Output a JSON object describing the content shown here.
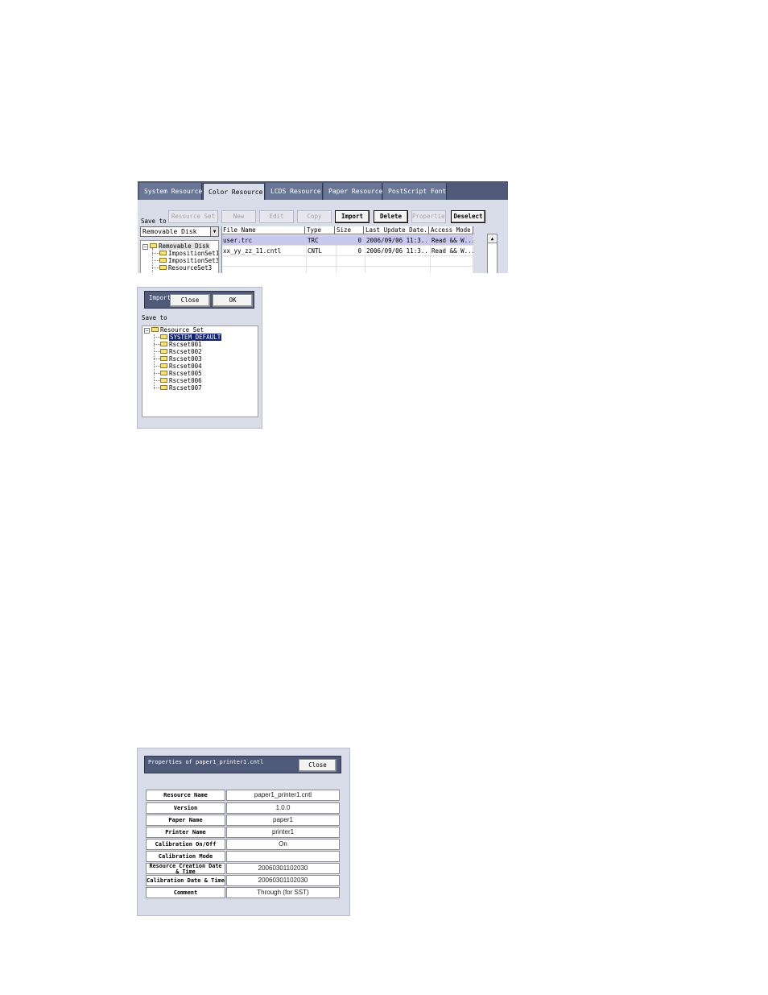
{
  "resource_window": {
    "tabs": [
      "System Resource",
      "Color Resource",
      "LCDS Resource",
      "Paper Resource",
      "PostScript Font"
    ],
    "active_tab": "Color Resource",
    "save_to_label": "Save to",
    "save_to_value": "Removable Disk",
    "buttons": {
      "resource_set": "Resource Set",
      "new": "New",
      "edit": "Edit",
      "copy": "Copy",
      "import": "Import",
      "delete": "Delete",
      "properties": "Properties",
      "deselect": "Deselect"
    },
    "tree": {
      "root": "Removable Disk",
      "children": [
        "ImpositionSet1",
        "ImpositionSet3",
        "ResourceSet3"
      ]
    },
    "columns": [
      "File Name",
      "Type",
      "Size",
      "Last Update Date...",
      "Access Mode"
    ],
    "rows": [
      {
        "file_name": "user.trc",
        "type": "TRC",
        "size": "0",
        "date": "2006/09/06 11:3...",
        "access": "Read && W..."
      },
      {
        "file_name": "xx_yy_zz_11.cntl",
        "type": "CNTL",
        "size": "0",
        "date": "2006/09/06 11:3...",
        "access": "Read && W..."
      }
    ]
  },
  "import_dialog": {
    "title": "Import",
    "close_label": "Close",
    "ok_label": "OK",
    "save_to_label": "Save to",
    "tree_root": "Resource Set",
    "tree_items": [
      "SYSTEM_DEFAULT",
      "Rscset001",
      "Rscset002",
      "Rscset003",
      "Rscset004",
      "Rscset005",
      "Rscset006",
      "Rscset007"
    ]
  },
  "properties_dialog": {
    "title": "Properties of paper1_printer1.cntl",
    "close_label": "Close",
    "rows": [
      {
        "key": "Resource Name",
        "value": "paper1_printer1.cntl"
      },
      {
        "key": "Version",
        "value": "1.0.0"
      },
      {
        "key": "Paper Name",
        "value": "paper1"
      },
      {
        "key": "Printer Name",
        "value": "printer1"
      },
      {
        "key": "Calibration On/Off",
        "value": "On"
      },
      {
        "key": "Calibration Mode",
        "value": ""
      },
      {
        "key_line1": "Resource Creation Date",
        "key_line2": "& Time",
        "value": "20060301102030"
      },
      {
        "key": "Calibration Date & Time",
        "value": "20060301102030"
      },
      {
        "key": "Comment",
        "value": "Through (for SST)"
      }
    ]
  }
}
